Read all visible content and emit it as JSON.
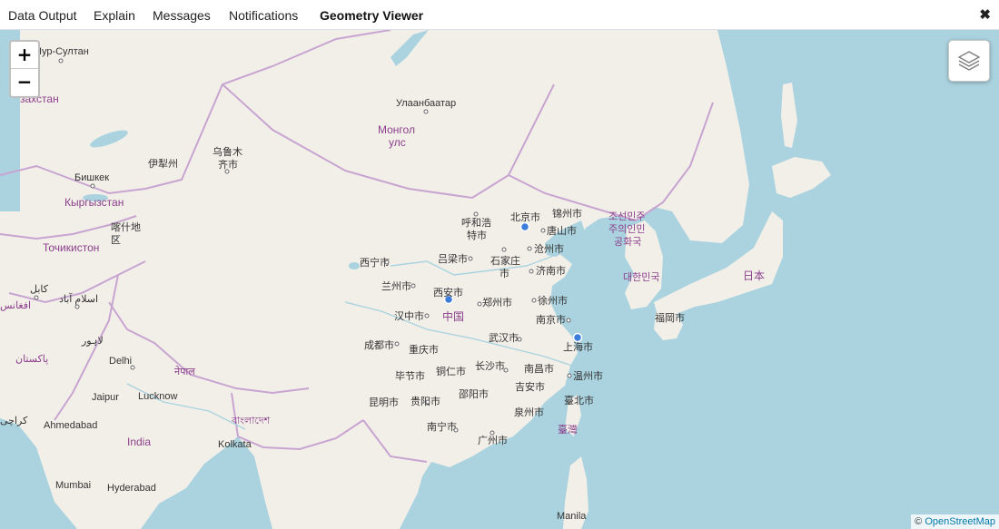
{
  "tabs": [
    {
      "label": "Data Output"
    },
    {
      "label": "Explain"
    },
    {
      "label": "Messages"
    },
    {
      "label": "Notifications"
    },
    {
      "label": "Geometry Viewer"
    }
  ],
  "close_icon": "close-icon",
  "zoom": {
    "in_label": "+",
    "out_label": "−"
  },
  "layers_icon": "layers-icon",
  "attribution": {
    "prefix": "©",
    "link_text": "OpenStreetMap"
  },
  "colors": {
    "water": "#aad3df",
    "land": "#f2efe9",
    "border": "#c8a4d1",
    "country_label": "#8b3f8b",
    "marker": "#3b7ddd"
  },
  "map_labels": {
    "astana": "Нур-Султан",
    "kazakhstan": "захстан",
    "ulaanbaatar": "Улаанбаатар",
    "mongolia_1": "Монгол",
    "mongolia_2": "улс",
    "urumqi_1": "乌鲁木",
    "urumqi_2": "齐市",
    "yining": "伊犁州",
    "bishkek": "Бишкек",
    "kyrgyzstan": "Кыргызстан",
    "kashgar_1": "喀什地",
    "kashgar_2": "区",
    "tajikistan": "Точикистон",
    "kabul": "کابل",
    "islamabad": "اسلام آباد",
    "afghanistan": "افغانس",
    "lahore": "لاہور",
    "pakistan": "پاکستان",
    "delhi": "Delhi",
    "nepal": "नेपाल",
    "jaipur": "Jaipur",
    "lucknow": "Lucknow",
    "karachi": "کراچی",
    "ahmedabad": "Ahmedabad",
    "bangladesh": "বাংলাদেশ",
    "india": "India",
    "kolkata": "Kolkata",
    "mumbai": "Mumbai",
    "hyderabad": "Hyderabad",
    "hohhot_1": "呼和浩",
    "hohhot_2": "特市",
    "beijing": "北京市",
    "jinzhou": "锦州市",
    "tangshan": "唐山市",
    "nk_1": "조선민주",
    "nk_2": "주의인민",
    "nk_3": "공화국",
    "cangzhou": "沧州市",
    "shijiazhuang_1": "石家庄",
    "shijiazhuang_2": "市",
    "lvliang": "吕梁市",
    "jinan": "济南市",
    "xining": "西宁市",
    "lanzhou": "兰州市",
    "xian": "西安市",
    "zhengzhou": "郑州市",
    "xuzhou": "徐州市",
    "korea": "대한민국",
    "japan": "日本",
    "hanzhong": "汉中市",
    "china": "中国",
    "nanjing": "南京市",
    "fukuoka": "福岡市",
    "chengdu": "成都市",
    "chongqing": "重庆市",
    "wuhan": "武汉市",
    "shanghai": "上海市",
    "bijie": "毕节市",
    "tongren": "铜仁市",
    "changsha": "长沙市",
    "nanchang": "南昌市",
    "wenzhou": "温州市",
    "kunming": "昆明市",
    "guiyang": "贵阳市",
    "shaoyang": "邵阳市",
    "jian": "吉安市",
    "taipei": "臺北市",
    "quanzhou": "泉州市",
    "taiwan": "臺灣",
    "nanning": "南宁市",
    "guangzhou": "广州市",
    "manila": "Manila"
  }
}
